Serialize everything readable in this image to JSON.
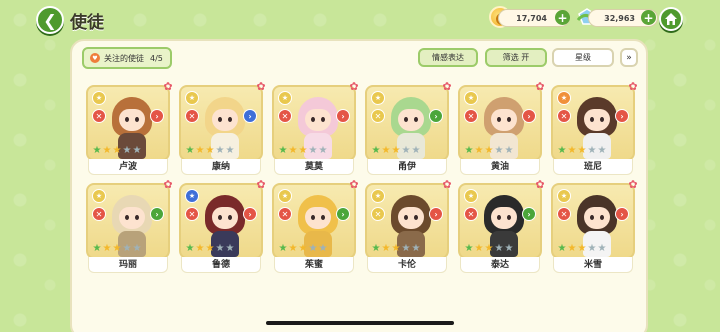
{
  "header": {
    "back_label": "<",
    "title": "使徒",
    "coins": "17,704",
    "gems": "32,963"
  },
  "toolbar": {
    "follow_label": "关注的使徒",
    "follow_count": "4/5",
    "emotion_label": "情感表达",
    "filter_label": "筛选 开",
    "star_label": "星级",
    "dropdown_icon": "»"
  },
  "colors": {
    "accent_green": "#4f9a2e",
    "card_bg": "#f3e3a0",
    "star_gold": "#f3b82b",
    "star_gray": "#9fb2b8"
  },
  "apostles": [
    {
      "name": "卢波",
      "stars": 3,
      "right_icon": "chevron-right",
      "right_color": "#e45546"
    },
    {
      "name": "康纳",
      "stars": 3,
      "right_icon": "chevron-right",
      "right_color": "#3f6fd8"
    },
    {
      "name": "莫莫",
      "stars": 3,
      "right_icon": "chevron-right",
      "right_color": "#e45546"
    },
    {
      "name": "甬伊",
      "stars": 3,
      "right_icon": "chevron-right",
      "right_color": "#4ba63a"
    },
    {
      "name": "黄油",
      "stars": 3,
      "right_icon": "chevron-right",
      "right_color": "#e45546"
    },
    {
      "name": "班尼",
      "stars": 3,
      "right_icon": "chevron-right",
      "right_color": "#e45546"
    },
    {
      "name": "玛丽",
      "stars": 3,
      "right_icon": "chevron-right",
      "right_color": "#4ba63a"
    },
    {
      "name": "鲁德",
      "stars": 3,
      "right_icon": "chevron-right",
      "right_color": "#e45546"
    },
    {
      "name": "茱蜜",
      "stars": 3,
      "right_icon": "chevron-right",
      "right_color": "#4ba63a"
    },
    {
      "name": "卡伦",
      "stars": 3,
      "right_icon": "chevron-right",
      "right_color": "#e45546"
    },
    {
      "name": "泰达",
      "stars": 3,
      "right_icon": "chevron-right",
      "right_color": "#4ba63a"
    },
    {
      "name": "米雪",
      "stars": 3,
      "right_icon": "chevron-right",
      "right_color": "#e45546"
    }
  ]
}
